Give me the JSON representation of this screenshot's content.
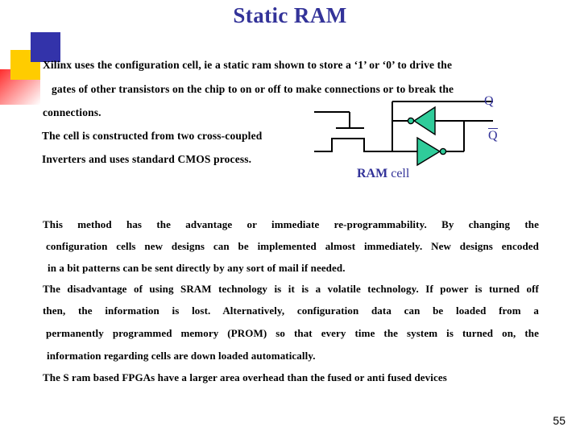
{
  "slide": {
    "title": "Static RAM",
    "page_number": "55",
    "title_color": "#333399",
    "accent_color": "#333399",
    "inverter_fill": "#2fcc9a"
  },
  "decor": {
    "blue_square": "#3333aa",
    "yellow_square": "#ffcc00",
    "red_gradient_square": "#ff2d2d"
  },
  "intro": {
    "lines": [
      "Xilinx uses the configuration cell, ie a static ram  shown to store a ‘1’ or ‘0’ to drive the",
      "gates of other transistors on the chip to on or off to  make connections or to break the",
      "connections.",
      "The cell is constructed from two cross-coupled",
      "Inverters and uses standard CMOS process."
    ]
  },
  "diagram": {
    "caption_bold": "RAM",
    "caption_rest": " cell",
    "q_label": "Q",
    "qbar_label": "Q",
    "qbar_overbar": true
  },
  "body": {
    "paragraphs": [
      {
        "justified": true,
        "lines": [
          "This  method  has  the  advantage  or  immediate  re-programmability.  By  changing  the",
          "configuration  cells new designs can be implemented almost immediately. New designs encoded",
          "in a bit patterns can be sent directly by any sort of mail if needed."
        ]
      },
      {
        "justified": true,
        "lines": [
          "The disadvantage of using SRAM technology is it is a volatile technology.  If power is turned off",
          "then,   the  information  is  lost.  Alternatively,  configuration  data  can  be  loaded  from  a",
          "permanently programmed memory (PROM) so that every time the system is turned on, the",
          "information regarding cells are down loaded automatically."
        ]
      },
      {
        "justified": false,
        "lines": [
          "The S ram based FPGAs have a larger area overhead than the fused or anti fused devices"
        ]
      }
    ]
  }
}
